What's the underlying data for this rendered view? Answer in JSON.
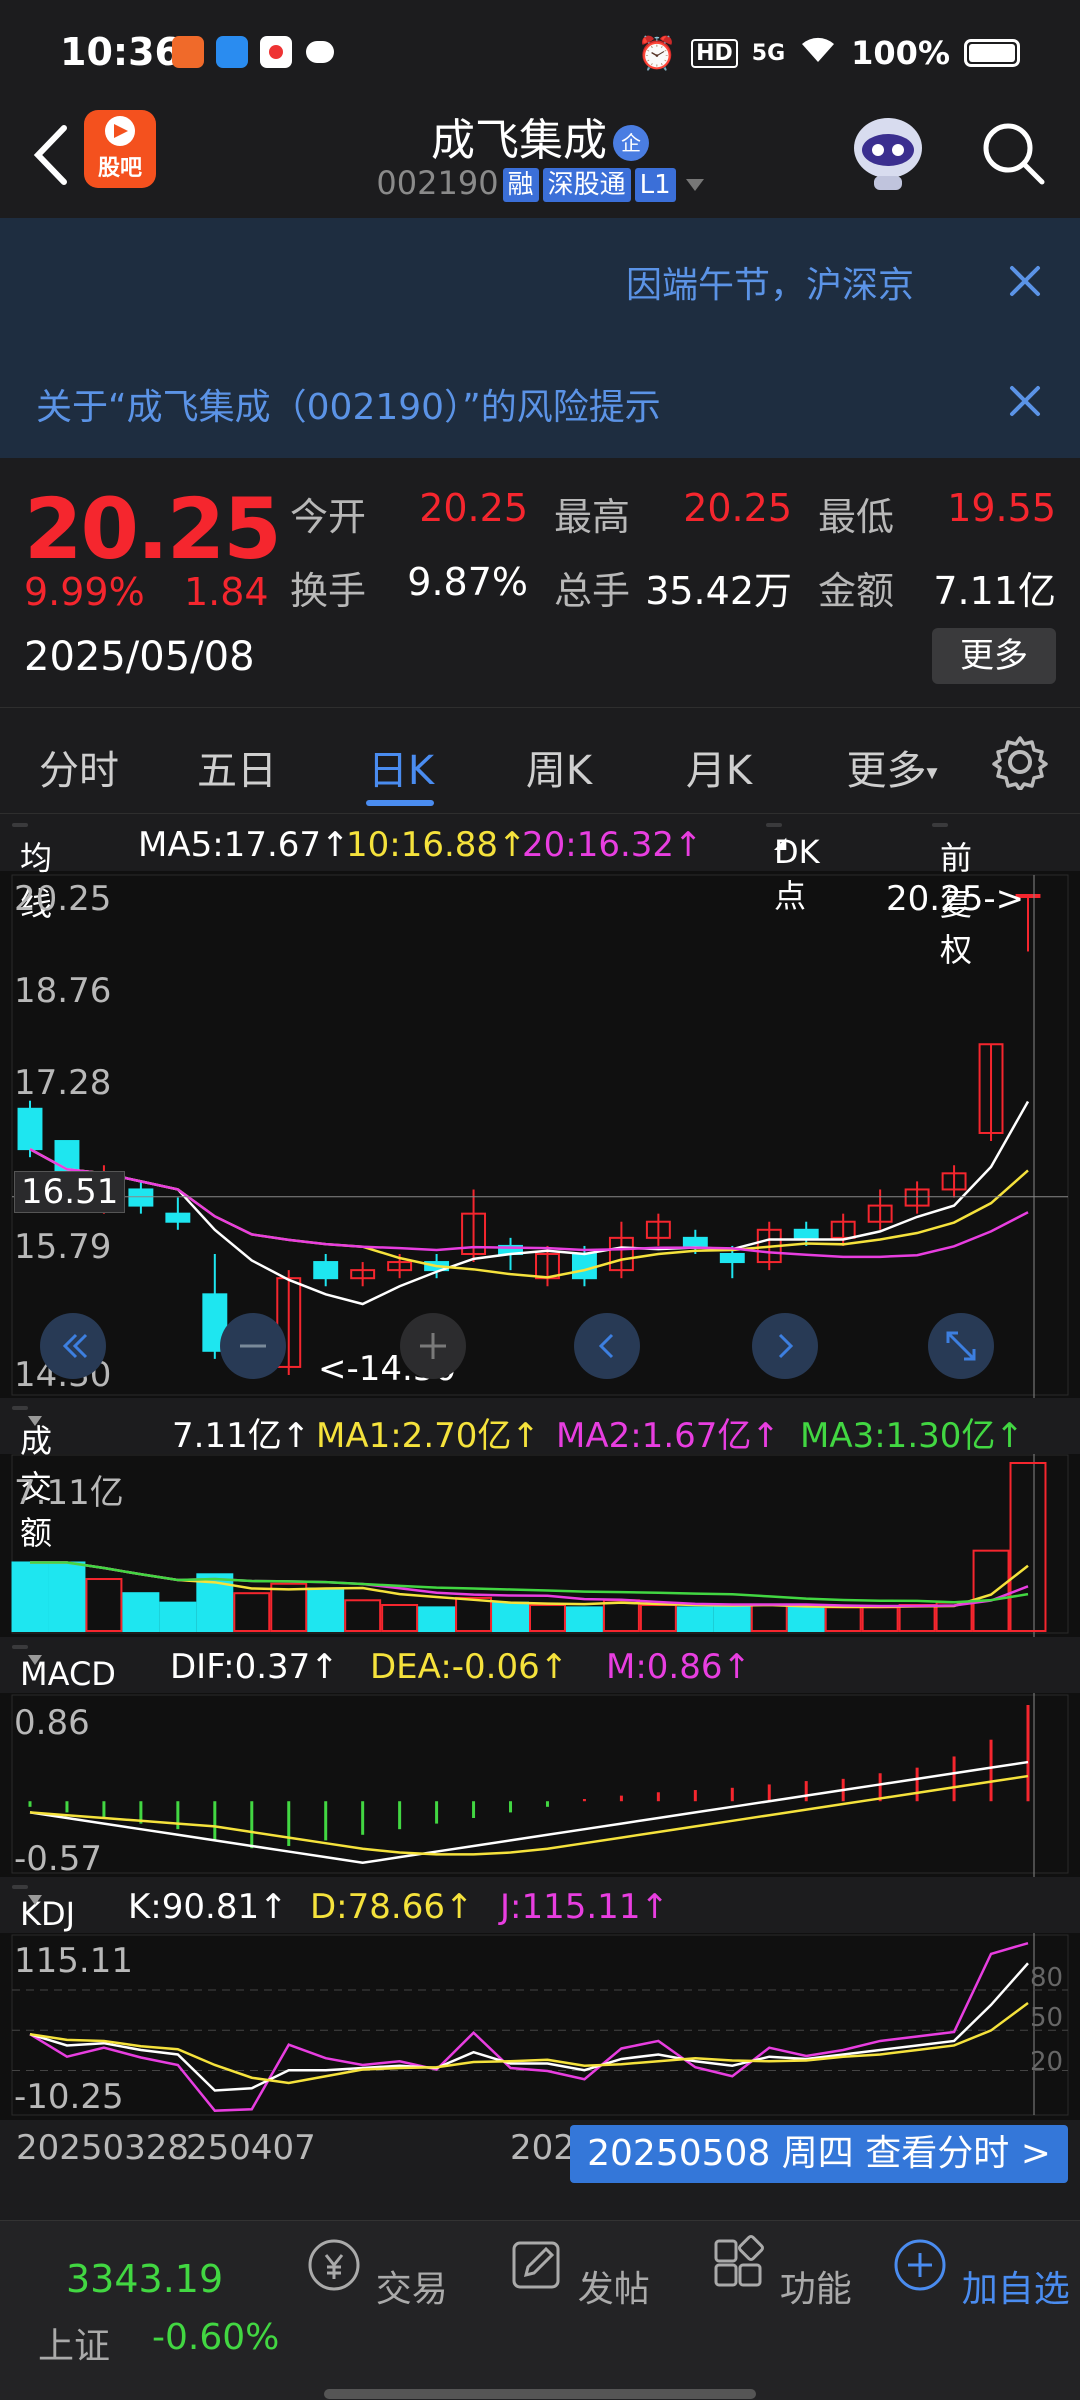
{
  "status": {
    "time": "10:36",
    "battery": "100%",
    "network": "5G",
    "hd": "HD"
  },
  "header": {
    "guba_label": "股吧",
    "stock_name": "成飞集成",
    "badge": "企",
    "code": "002190",
    "tags": [
      "融",
      "深股通",
      "L1"
    ]
  },
  "notices": [
    {
      "text": "因端午节，沪深京"
    },
    {
      "text": "关于“成飞集成（002190）”的风险提示"
    }
  ],
  "quote": {
    "price": "20.25",
    "change_pct": "9.99%",
    "change": "1.84",
    "date": "2025/05/08",
    "open_label": "今开",
    "open": "20.25",
    "high_label": "最高",
    "high": "20.25",
    "low_label": "最低",
    "low": "19.55",
    "turnover_label": "换手",
    "turnover": "9.87%",
    "volume_label": "总手",
    "volume": "35.42万",
    "amount_label": "金额",
    "amount": "7.11亿",
    "more_label": "更多"
  },
  "tabs": [
    "分时",
    "五日",
    "日K",
    "周K",
    "月K",
    "更多"
  ],
  "active_tab": "日K",
  "ma_bar": {
    "label": "均线",
    "ma5": "MA5:17.67↑",
    "ma10": "10:16.88↑",
    "ma20": "20:16.32↑",
    "dk": "DK点",
    "fq": "前复权"
  },
  "kline_axis": {
    "top": "20.25",
    "y2": "18.76",
    "y3": "17.28",
    "y4": "15.79",
    "bottom": "14.30",
    "cursor": "16.51",
    "max_marker": "20.25->",
    "min_marker": "<-14.30"
  },
  "vol_bar": {
    "label": "成交额",
    "value": "7.11亿↑",
    "ma1": "MA1:2.70亿↑",
    "ma2": "MA2:1.67亿↑",
    "ma3": "MA3:1.30亿↑",
    "axis_top": "7.11亿"
  },
  "macd_bar": {
    "label": "MACD",
    "dif": "DIF:0.37↑",
    "dea": "DEA:-0.06↑",
    "m": "M:0.86↑",
    "axis_top": "0.86",
    "axis_bottom": "-0.57"
  },
  "kdj_bar": {
    "label": "KDJ",
    "k": "K:90.81↑",
    "d": "D:78.66↑",
    "j": "J:115.11↑",
    "axis_top": "115.11",
    "axis_bottom": "-10.25",
    "ref": [
      "80",
      "50",
      "20"
    ]
  },
  "dates": {
    "d1": "20250328",
    "d2": "250407",
    "d3": "202",
    "view": "20250508 周四 查看分时 >"
  },
  "bottom_nav": {
    "index_value": "3343.19",
    "index_name": "上证",
    "index_change": "-0.60%",
    "items": [
      "交易",
      "发帖",
      "功能",
      "加自选"
    ]
  },
  "colors": {
    "up": "#f5262e",
    "down": "#1ee6f0",
    "accent": "#4a8cf0",
    "ma5": "#ffffff",
    "ma10": "#f5e23c",
    "ma20": "#e83ee0"
  },
  "chart_data": {
    "type": "candlestick",
    "ylim": [
      14.3,
      20.25
    ],
    "candles": [
      {
        "o": 17.6,
        "c": 17.1,
        "h": 17.7,
        "l": 17.0
      },
      {
        "o": 17.2,
        "c": 16.6,
        "h": 17.2,
        "l": 16.5
      },
      {
        "o": 16.5,
        "c": 16.7,
        "h": 16.9,
        "l": 16.3
      },
      {
        "o": 16.6,
        "c": 16.4,
        "h": 16.7,
        "l": 16.3
      },
      {
        "o": 16.3,
        "c": 16.2,
        "h": 16.5,
        "l": 16.1
      },
      {
        "o": 15.3,
        "c": 14.6,
        "h": 15.8,
        "l": 14.5
      },
      {
        "o": 14.7,
        "c": 14.7,
        "h": 14.9,
        "l": 14.4
      },
      {
        "o": 14.4,
        "c": 15.5,
        "h": 15.6,
        "l": 14.3
      },
      {
        "o": 15.7,
        "c": 15.5,
        "h": 15.8,
        "l": 15.4
      },
      {
        "o": 15.5,
        "c": 15.6,
        "h": 15.7,
        "l": 15.4
      },
      {
        "o": 15.6,
        "c": 15.7,
        "h": 15.8,
        "l": 15.5
      },
      {
        "o": 15.7,
        "c": 15.6,
        "h": 15.8,
        "l": 15.5
      },
      {
        "o": 15.8,
        "c": 16.3,
        "h": 16.6,
        "l": 15.7
      },
      {
        "o": 15.9,
        "c": 15.8,
        "h": 16.0,
        "l": 15.6
      },
      {
        "o": 15.5,
        "c": 15.8,
        "h": 15.9,
        "l": 15.4
      },
      {
        "o": 15.8,
        "c": 15.5,
        "h": 15.9,
        "l": 15.4
      },
      {
        "o": 15.6,
        "c": 16.0,
        "h": 16.2,
        "l": 15.5
      },
      {
        "o": 16.0,
        "c": 16.2,
        "h": 16.3,
        "l": 15.9
      },
      {
        "o": 16.0,
        "c": 15.9,
        "h": 16.1,
        "l": 15.8
      },
      {
        "o": 15.8,
        "c": 15.7,
        "h": 15.9,
        "l": 15.5
      },
      {
        "o": 15.7,
        "c": 16.1,
        "h": 16.2,
        "l": 15.6
      },
      {
        "o": 16.1,
        "c": 16.0,
        "h": 16.2,
        "l": 15.9
      },
      {
        "o": 16.0,
        "c": 16.2,
        "h": 16.3,
        "l": 15.9
      },
      {
        "o": 16.2,
        "c": 16.4,
        "h": 16.6,
        "l": 16.1
      },
      {
        "o": 16.4,
        "c": 16.6,
        "h": 16.7,
        "l": 16.3
      },
      {
        "o": 16.6,
        "c": 16.8,
        "h": 16.9,
        "l": 16.5
      },
      {
        "o": 17.3,
        "c": 18.4,
        "h": 18.4,
        "l": 17.2
      },
      {
        "o": 20.25,
        "c": 20.25,
        "h": 20.25,
        "l": 19.55
      }
    ],
    "volume": [
      2.9,
      2.9,
      2.2,
      1.6,
      1.2,
      2.4,
      1.6,
      2.0,
      1.8,
      1.3,
      1.1,
      1.0,
      1.4,
      1.2,
      1.1,
      1.0,
      1.3,
      1.1,
      1.0,
      1.0,
      1.1,
      1.0,
      1.0,
      1.0,
      1.1,
      1.2,
      3.4,
      7.11
    ],
    "macd": [
      -0.05,
      -0.1,
      -0.15,
      -0.2,
      -0.25,
      -0.35,
      -0.42,
      -0.4,
      -0.35,
      -0.3,
      -0.25,
      -0.2,
      -0.15,
      -0.1,
      -0.05,
      0.02,
      0.05,
      0.08,
      0.1,
      0.12,
      0.15,
      0.18,
      0.2,
      0.25,
      0.3,
      0.4,
      0.55,
      0.86
    ]
  }
}
